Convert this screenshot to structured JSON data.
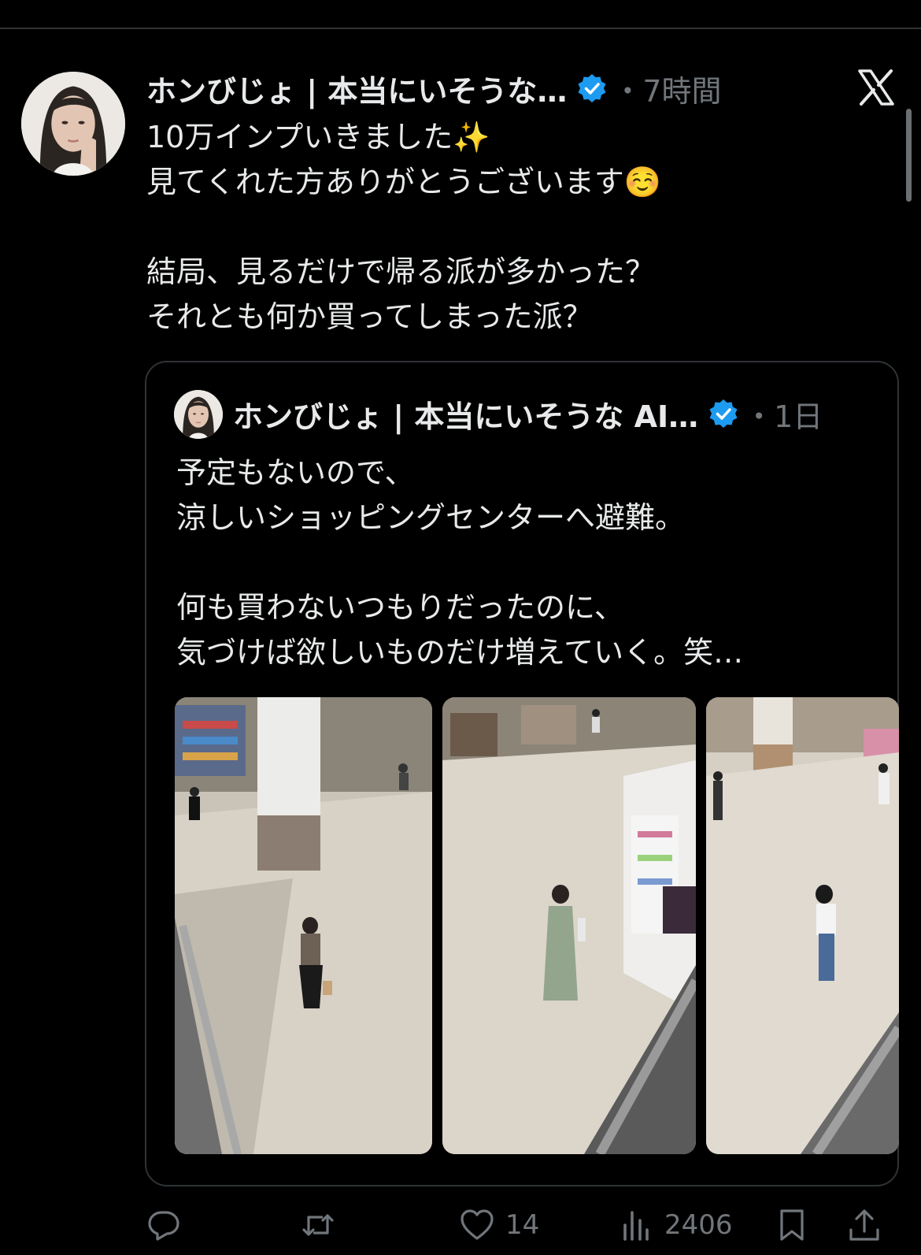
{
  "post": {
    "author_name": "ホンびじょ | 本当にいそうな…",
    "time": "・7時間",
    "text_lines": [
      "10万インプいきました✨",
      "見てくれた方ありがとうございます☺️",
      "",
      "結局、見るだけで帰る派が多かった？",
      "それとも何か買ってしまった派？"
    ]
  },
  "quoted": {
    "author_name": "ホンびじょ | 本当にいそうな AI…",
    "time": "・1日",
    "text_lines": [
      "予定もないので、",
      "涼しいショッピングセンターへ避難。",
      "",
      "何も買わないつもりだったのに、",
      "気づけば欲しいものだけ増えていく。笑…"
    ]
  },
  "actions": {
    "reply_count": "",
    "repost_count": "",
    "like_count": "14",
    "view_count": "2406"
  },
  "icons": {
    "brand": "x-logo-icon",
    "verified": "verified-badge-icon",
    "reply": "reply-icon",
    "repost": "repost-icon",
    "like": "heart-icon",
    "views": "views-chart-icon",
    "bookmark": "bookmark-icon",
    "share": "share-icon"
  },
  "colors": {
    "background": "#000000",
    "text": "#e7e9ea",
    "muted": "#71767b",
    "verified": "#1d9bf0",
    "border": "#2f3336"
  }
}
